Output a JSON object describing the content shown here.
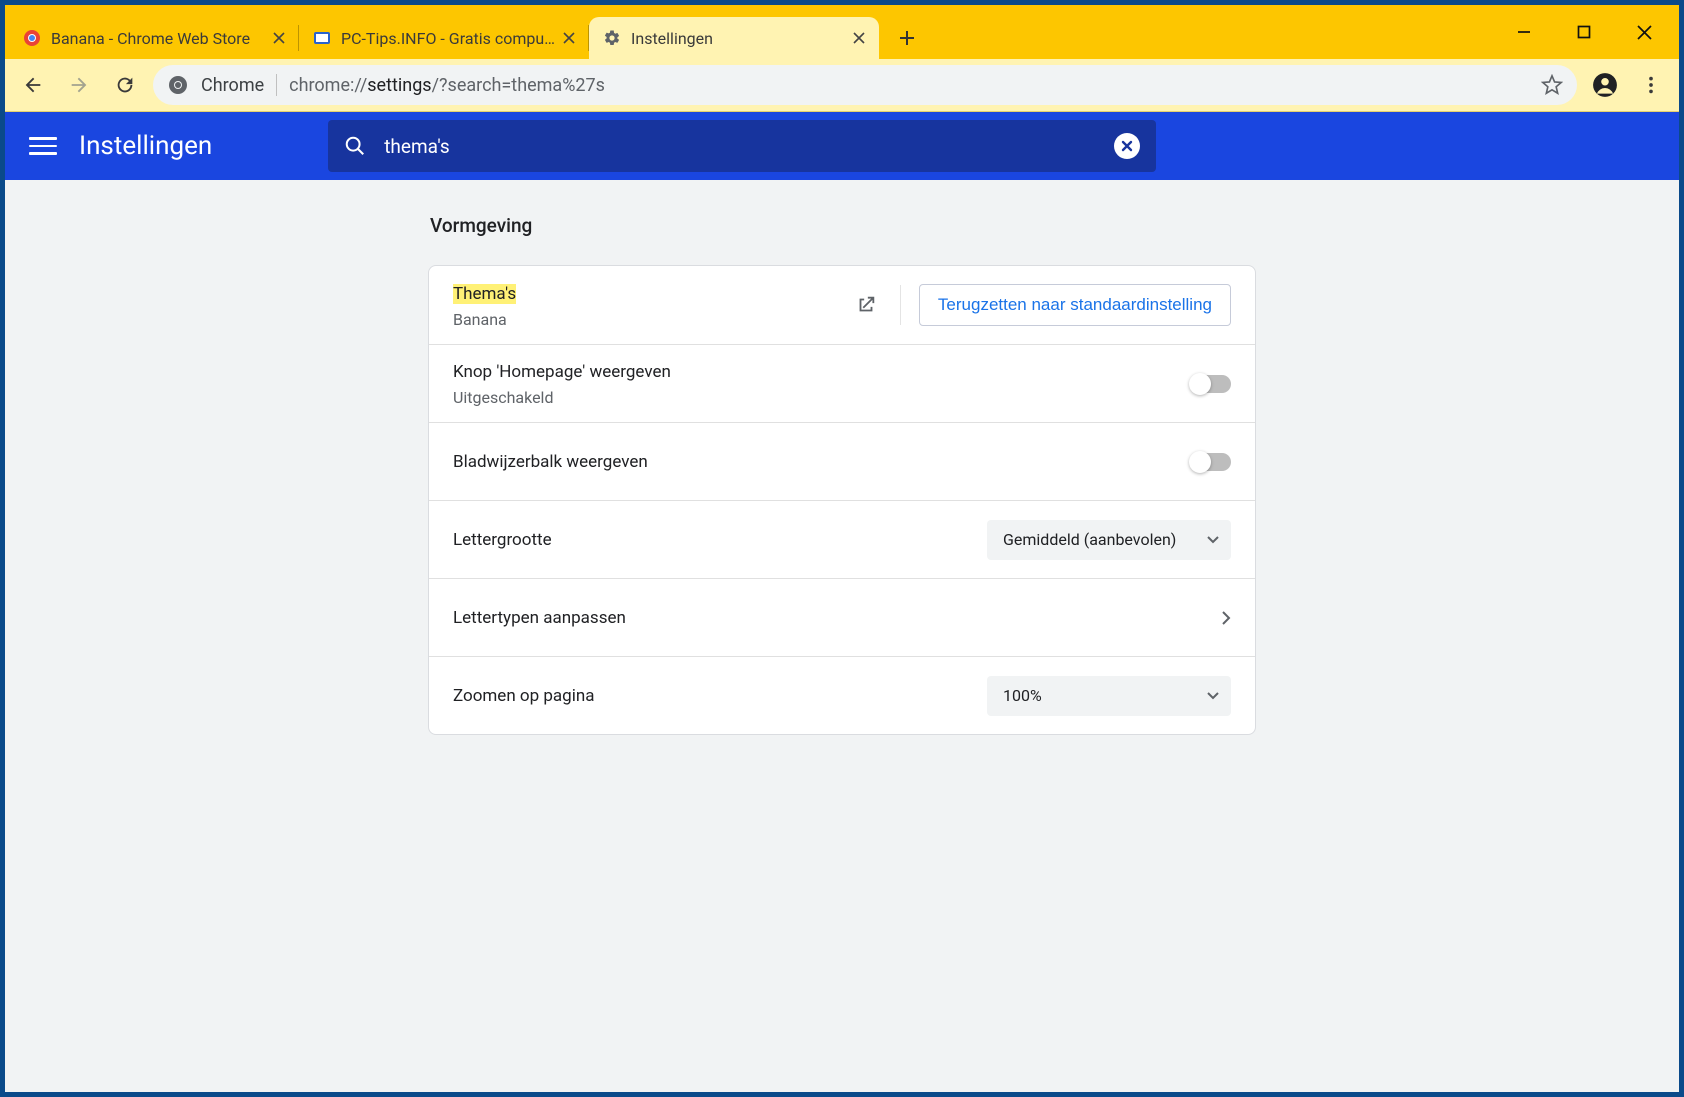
{
  "browser": {
    "tabs": [
      {
        "title": "Banana - Chrome Web Store"
      },
      {
        "title": "PC-Tips.INFO - Gratis computer t"
      },
      {
        "title": "Instellingen"
      }
    ],
    "active_tab": 2,
    "omnibox_label": "Chrome",
    "omnibox_prefix": "chrome://",
    "omnibox_bold": "settings",
    "omnibox_suffix": "/?search=thema%27s"
  },
  "settings": {
    "app_title": "Instellingen",
    "search_value": "thema's",
    "section": "Vormgeving",
    "themes": {
      "label": "Thema's",
      "value": "Banana",
      "reset_button": "Terugzetten naar standaardinstelling"
    },
    "homepage": {
      "label": "Knop 'Homepage' weergeven",
      "status": "Uitgeschakeld"
    },
    "bookmarks_bar": {
      "label": "Bladwijzerbalk weergeven"
    },
    "font_size": {
      "label": "Lettergrootte",
      "value": "Gemiddeld (aanbevolen)"
    },
    "customize_fonts": {
      "label": "Lettertypen aanpassen"
    },
    "page_zoom": {
      "label": "Zoomen op pagina",
      "value": "100%"
    }
  }
}
